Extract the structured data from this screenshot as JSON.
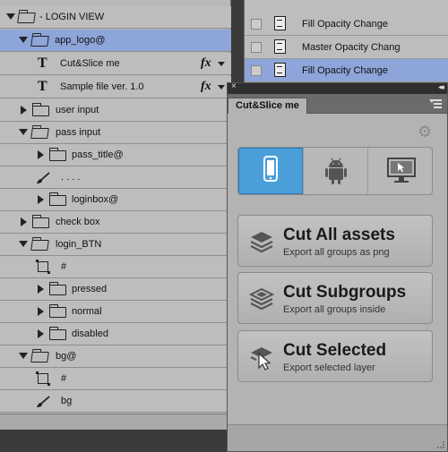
{
  "layers": {
    "rows": [
      {
        "label": "- LOGIN VIEW"
      },
      {
        "label": "app_logo@"
      },
      {
        "label": "Cut&Slice me",
        "fx": "fx"
      },
      {
        "label": "Sample file ver. 1.0",
        "fx": "fx"
      },
      {
        "label": "user input"
      },
      {
        "label": "pass input"
      },
      {
        "label": "pass_title@"
      },
      {
        "label": ". . . ."
      },
      {
        "label": "loginbox@"
      },
      {
        "label": "check box"
      },
      {
        "label": "login_BTN"
      },
      {
        "label": "#"
      },
      {
        "label": "pressed"
      },
      {
        "label": "normal"
      },
      {
        "label": "disabled"
      },
      {
        "label": "bg@"
      },
      {
        "label": "#"
      },
      {
        "label": "bg"
      }
    ],
    "text_layer_icon": "T"
  },
  "history": {
    "rows": [
      {
        "label": "Fill Opacity Change"
      },
      {
        "label": "Master Opacity Chang"
      },
      {
        "label": "Fill Opacity Change"
      }
    ]
  },
  "cutslice": {
    "close_icon": "×",
    "collapse_icon": "◂◂",
    "tab_label": "Cut&Slice me",
    "gear_icon": "⚙",
    "platforms": [
      "ios",
      "android",
      "desktop"
    ],
    "accent": "#4a9fd9",
    "actions": [
      {
        "title": "Cut All assets",
        "subtitle": "Export all groups as png"
      },
      {
        "title": "Cut Subgroups",
        "subtitle": "Export all groups inside"
      },
      {
        "title": "Cut Selected",
        "subtitle": "Export selected layer"
      }
    ]
  }
}
